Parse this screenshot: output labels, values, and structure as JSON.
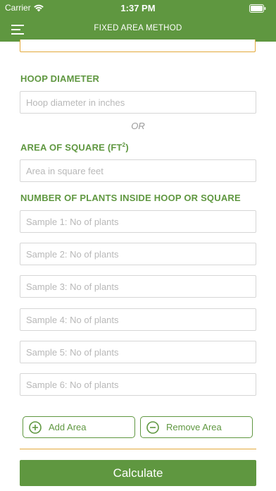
{
  "status_bar": {
    "carrier": "Carrier",
    "time": "1:37 PM"
  },
  "nav": {
    "title": "FIXED AREA METHOD",
    "menu_icon": "hamburger-menu-icon"
  },
  "form": {
    "hoop_label": "HOOP DIAMETER",
    "hoop_placeholder": "Hoop diameter in inches",
    "or_text": "OR",
    "square_label": "AREA OF SQUARE (FT",
    "square_label_sup": "2",
    "square_label_end": ")",
    "square_placeholder": "Area in square feet",
    "plants_label": "NUMBER OF PLANTS INSIDE HOOP OR SQUARE",
    "samples": [
      {
        "placeholder": "Sample 1: No of plants"
      },
      {
        "placeholder": "Sample 2: No of plants"
      },
      {
        "placeholder": "Sample 3: No of plants"
      },
      {
        "placeholder": "Sample 4: No of plants"
      },
      {
        "placeholder": "Sample 5: No of plants"
      },
      {
        "placeholder": "Sample 6: No of plants"
      }
    ]
  },
  "actions": {
    "add_label": "Add Area",
    "remove_label": "Remove Area",
    "calculate_label": "Calculate"
  },
  "colors": {
    "brand_green": "#5f9740",
    "accent_orange": "#e3a93a"
  }
}
